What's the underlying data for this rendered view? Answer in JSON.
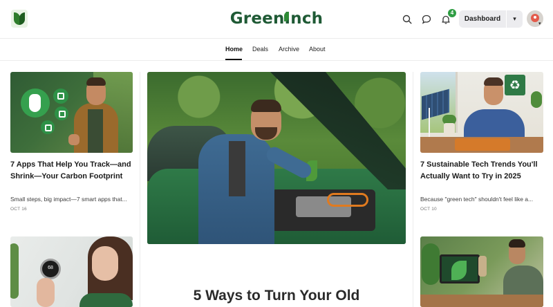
{
  "header": {
    "brand_part1": "Green",
    "brand_part2": "Inch",
    "notification_count": "4",
    "dashboard_label": "Dashboard",
    "dashboard_caret": "▾",
    "avatar_caret": "▾"
  },
  "nav": {
    "items": [
      {
        "label": "Home",
        "active": true
      },
      {
        "label": "Deals"
      },
      {
        "label": "Archive"
      },
      {
        "label": "About"
      }
    ]
  },
  "cards": {
    "left_top": {
      "title": "7 Apps That Help You Track—and Shrink—Your Carbon Footprint",
      "excerpt": "Small steps, big impact—7 smart apps that...",
      "date": "OCT 16"
    },
    "hero": {
      "title": "5 Ways to Turn Your Old"
    },
    "right_top": {
      "title": "7 Sustainable Tech Trends You'll Actually Want to Try in 2025",
      "excerpt": "Because \"green tech\" shouldn't feel like a...",
      "date": "OCT 10"
    },
    "left_bottom": {
      "thermostat_value": "68"
    }
  },
  "icons": {
    "logo": "leaf-logo-icon",
    "search": "search-icon",
    "chat": "chat-bubble-icon",
    "notifications": "bell-icon",
    "recycle": "♻"
  },
  "colors": {
    "brand_green": "#1f5a35",
    "badge_green": "#2f9e44"
  }
}
